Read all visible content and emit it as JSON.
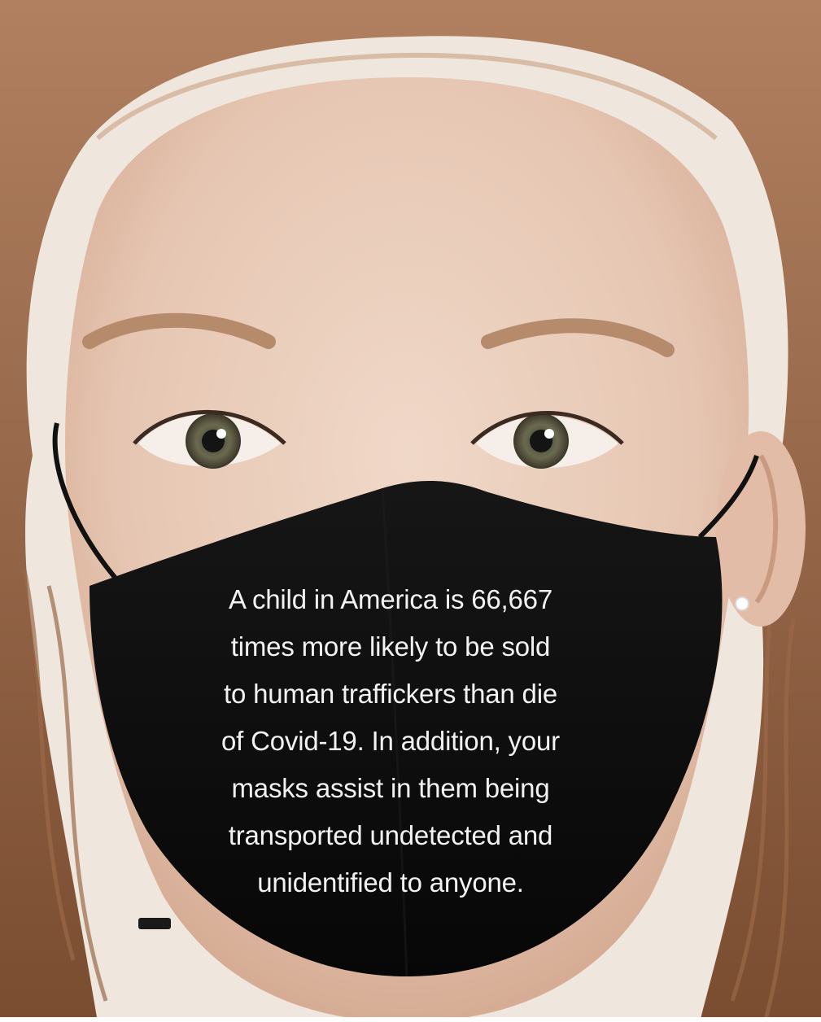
{
  "photo": {
    "subject": "child-face-with-black-face-mask",
    "colors": {
      "skin": "#e8cdbb",
      "hair": "#8a5a3a",
      "mask": "#0c0c0c",
      "text": "#f2f2f2",
      "eye": "#5d5a45"
    }
  },
  "mask_text": {
    "lines": [
      "A child in America is 66,667",
      "times more likely to be sold",
      "to human traffickers than die",
      "of Covid-19. In addition, your",
      "masks assist in them being",
      "transported undetected and",
      "unidentified to anyone."
    ]
  }
}
